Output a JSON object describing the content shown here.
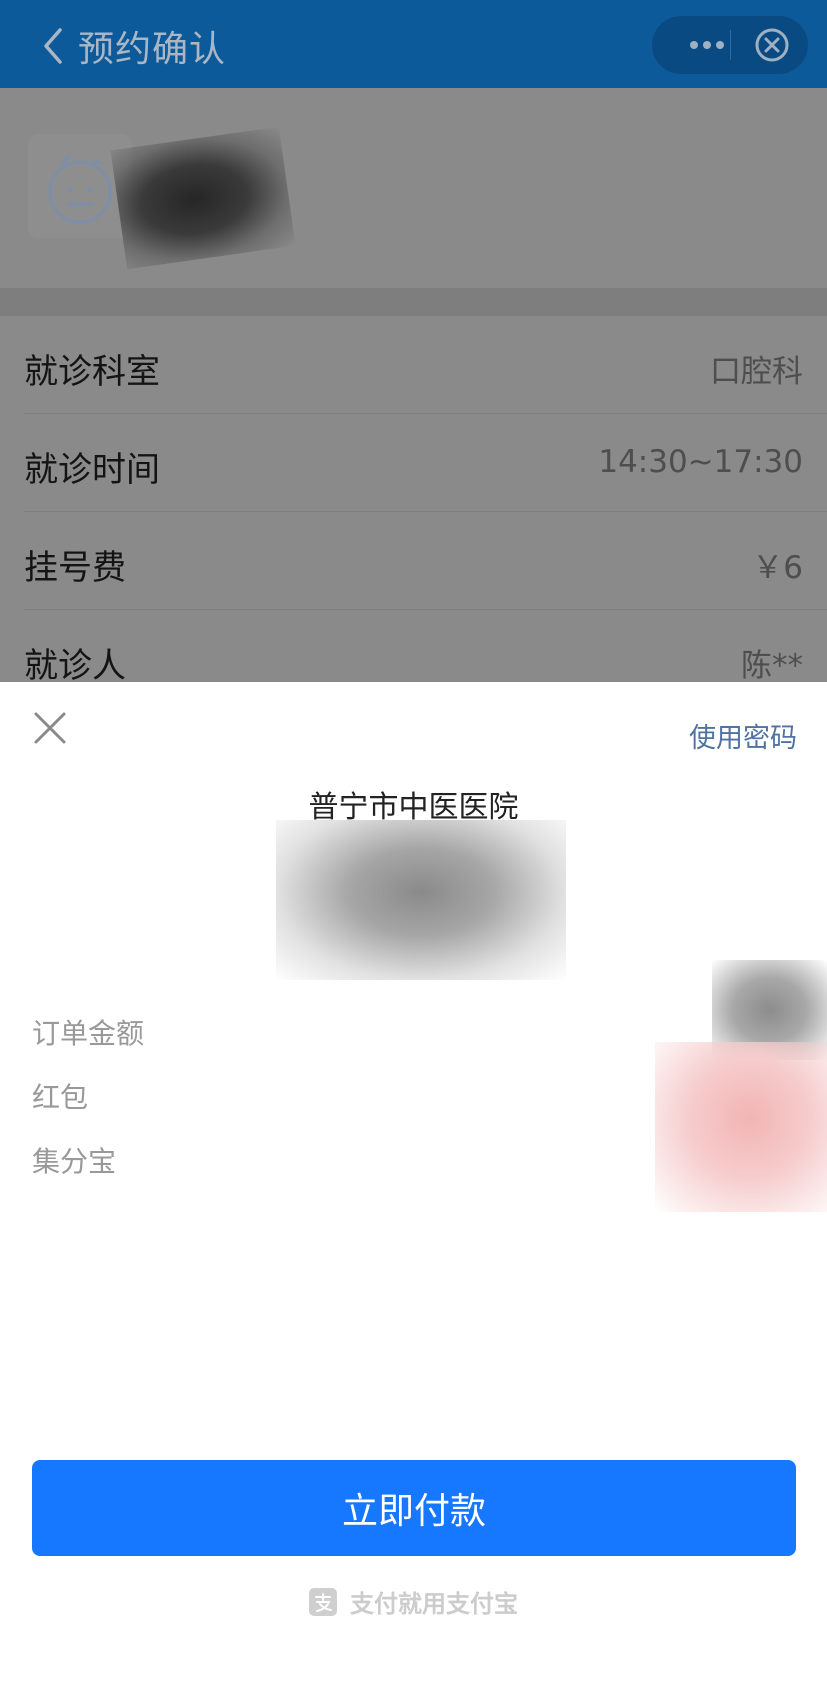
{
  "header": {
    "title": "预约确认",
    "back_icon": "chevron-left-icon",
    "more_icon": "ellipsis-icon",
    "close_icon": "circle-close-icon"
  },
  "info_rows": [
    {
      "label": "就诊科室",
      "value": "口腔科"
    },
    {
      "label": "就诊时间",
      "value": "14:30~17:30"
    },
    {
      "label": "挂号费",
      "value": "￥6"
    },
    {
      "label": "就诊人",
      "value": "陈**"
    }
  ],
  "payment_sheet": {
    "use_password": "使用密码",
    "merchant": "普宁市中医医院",
    "details": [
      "订单金额",
      "红包",
      "集分宝"
    ],
    "pay_button": "立即付款",
    "brand": "支付就用支付宝"
  },
  "colors": {
    "topbar": "#0d5a9b",
    "primary_button": "#1677ff",
    "link": "#5173a3"
  }
}
